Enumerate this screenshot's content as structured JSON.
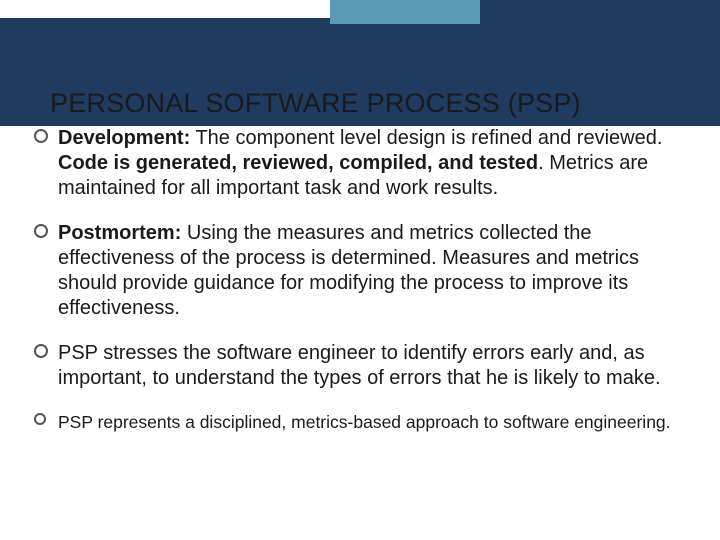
{
  "slide": {
    "title": "PERSONAL SOFTWARE PROCESS (PSP)",
    "bullets": [
      {
        "lead": "Development:",
        "pre": " The component level design is refined and reviewed. ",
        "bold": "Code is generated, reviewed, compiled, and tested",
        "post": ". Metrics are maintained for all important task and work results.",
        "size": "normal"
      },
      {
        "lead": "Postmortem:",
        "pre": " Using the measures and metrics collected the effectiveness of the process is determined. Measures and metrics should provide guidance for modifying the process to improve its effectiveness.",
        "bold": "",
        "post": "",
        "size": "normal"
      },
      {
        "lead": "",
        "pre": "PSP stresses the software engineer to identify errors early and, as important, to understand the types of errors that he is likely to make.",
        "bold": "",
        "post": "",
        "size": "normal"
      },
      {
        "lead": "",
        "pre": "PSP represents a disciplined, metrics-based approach to software engineering.",
        "bold": "",
        "post": "",
        "size": "small"
      }
    ]
  }
}
